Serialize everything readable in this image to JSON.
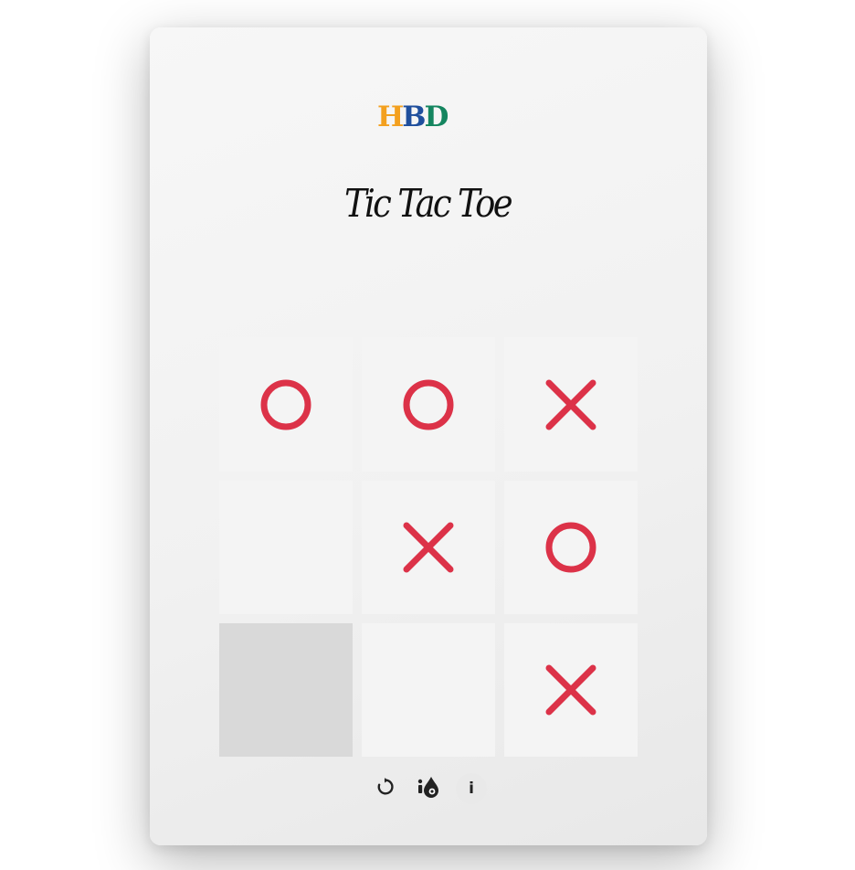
{
  "logo": {
    "letters": [
      "H",
      "B",
      "D"
    ],
    "colors": [
      "#f3a01f",
      "#1f4f9d",
      "#14855f"
    ]
  },
  "title": "Tic Tac Toe",
  "board": {
    "cells": [
      [
        "O",
        "O",
        "X"
      ],
      [
        "",
        "X",
        "O"
      ],
      [
        "",
        "",
        "X"
      ]
    ],
    "hovered_cell": [
      2,
      0
    ],
    "mark_color": "#dc3248"
  },
  "toolbar": {
    "buttons": [
      {
        "name": "restart-button",
        "icon": "restart-icon"
      },
      {
        "name": "theme-toggle-button",
        "icon": "paint-drop-icon"
      },
      {
        "name": "info-button",
        "icon": "info-icon",
        "label": "i"
      }
    ]
  }
}
